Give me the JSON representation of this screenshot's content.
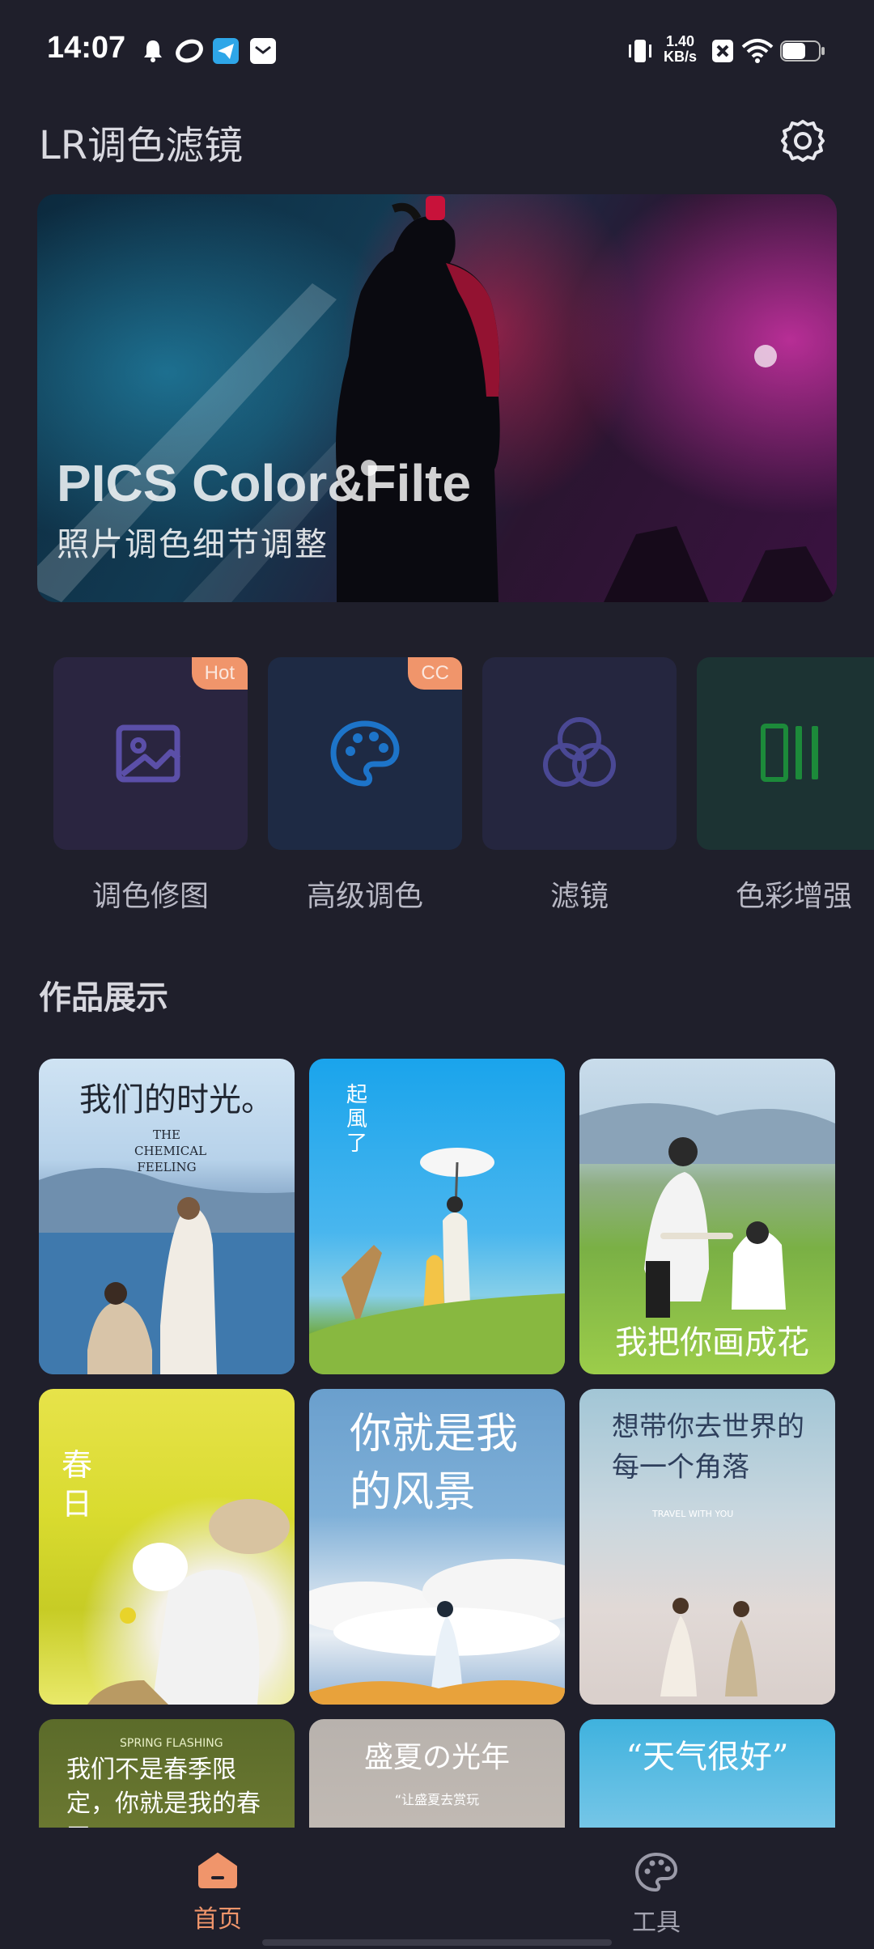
{
  "status_bar": {
    "time": "14:07",
    "net_speed_value": "1.40",
    "net_speed_unit": "KB/s",
    "icons": [
      "bell-icon",
      "swirl-app-icon",
      "telegram-icon",
      "mail-icon",
      "vibrate-icon",
      "sim-x-icon",
      "wifi-icon",
      "battery-icon"
    ]
  },
  "header": {
    "title": "LR调色滤镜",
    "settings_icon": "gear-icon"
  },
  "banner": {
    "title": "PICS Color&Filte",
    "subtitle": "照片调色细节调整"
  },
  "tools": [
    {
      "label": "调色修图",
      "badge": "Hot",
      "icon": "image-icon",
      "color": "#5b4fa8",
      "bg": "#2a2540"
    },
    {
      "label": "高级调色",
      "badge": "CC",
      "icon": "palette-icon",
      "color": "#1d74c9",
      "bg": "#1e2a44"
    },
    {
      "label": "滤镜",
      "badge": "",
      "icon": "rings-icon",
      "color": "#4a4894",
      "bg": "#25263f"
    },
    {
      "label": "色彩增强",
      "badge": "",
      "icon": "bars-icon",
      "color": "#1c8a3a",
      "bg": "#1c3333"
    }
  ],
  "works": {
    "title": "作品展示",
    "items": [
      {
        "text": "我们的时光。",
        "sub": "THE CHEMICAL FEELING"
      },
      {
        "text": "起風了",
        "sub": ""
      },
      {
        "text": "我把你画成花",
        "sub": ""
      },
      {
        "text": "春日",
        "sub": ""
      },
      {
        "text": "你就是我的风景",
        "sub": ""
      },
      {
        "text": "想带你去世界的每一个角落",
        "sub": "TRAVEL WITH YOU"
      },
      {
        "text": "我们不是春季限定，你就是我的春天",
        "sub": "SPRING FLASHING"
      },
      {
        "text": "盛夏の光年",
        "sub": "“让盛夏去赏玩"
      },
      {
        "text": "“天气很好”",
        "sub": ""
      }
    ]
  },
  "bottom_nav": {
    "items": [
      {
        "label": "首页",
        "icon": "home-icon",
        "active": true
      },
      {
        "label": "工具",
        "icon": "palette-icon",
        "active": false
      }
    ],
    "active_color": "#f0956b"
  }
}
